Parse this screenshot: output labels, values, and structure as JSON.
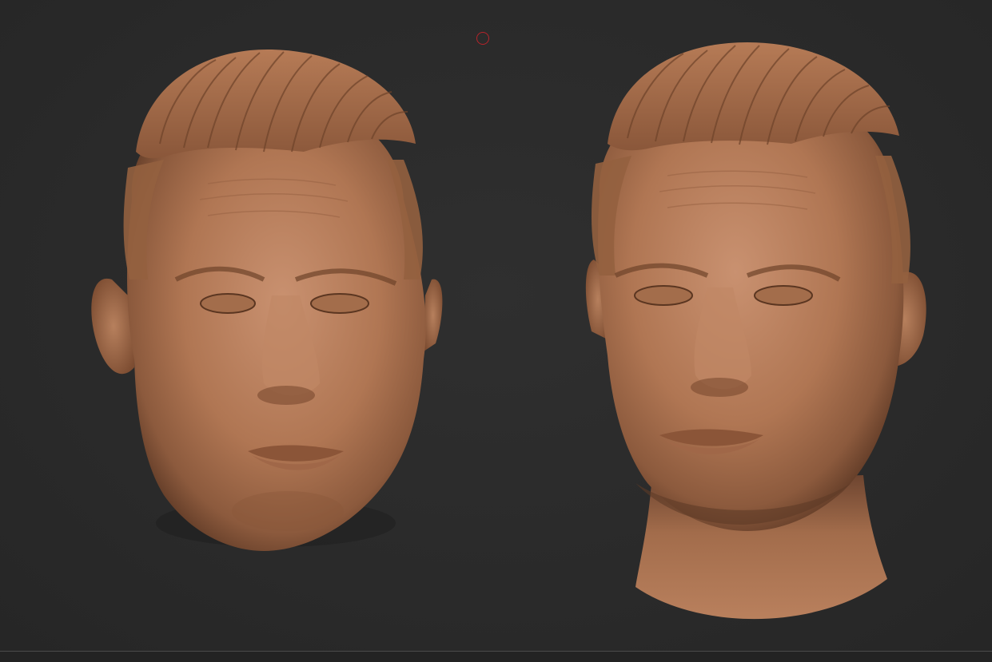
{
  "viewport": {
    "background": "#2b2b2b",
    "material_color": "#b47a57"
  },
  "objects": [
    {
      "name": "head-left",
      "description_icon": "sculpted-head-icon"
    },
    {
      "name": "head-right",
      "description_icon": "sculpted-head-neck-icon"
    }
  ],
  "cursor": {
    "icon": "brush-circle-icon",
    "color": "#b5242b"
  }
}
